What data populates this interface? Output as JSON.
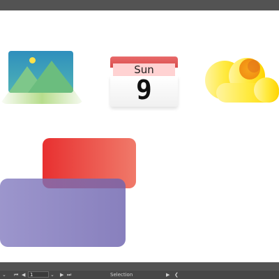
{
  "calendar": {
    "day_name": "Sun",
    "day_number": "9"
  },
  "status_bar": {
    "zoom_dropdown": "⌄",
    "first_page": "⏮",
    "prev_page": "◀",
    "page_number": "1",
    "page_dropdown": "⌄",
    "next_page": "▶",
    "last_page": "⏭",
    "tool_label": "Selection",
    "play_icon": "▶",
    "collapse_icon": "❮"
  },
  "colors": {
    "chrome": "#535353",
    "canvas": "#ffffff",
    "red_rect": "#e83030",
    "purple_rect": "#7f78be"
  }
}
